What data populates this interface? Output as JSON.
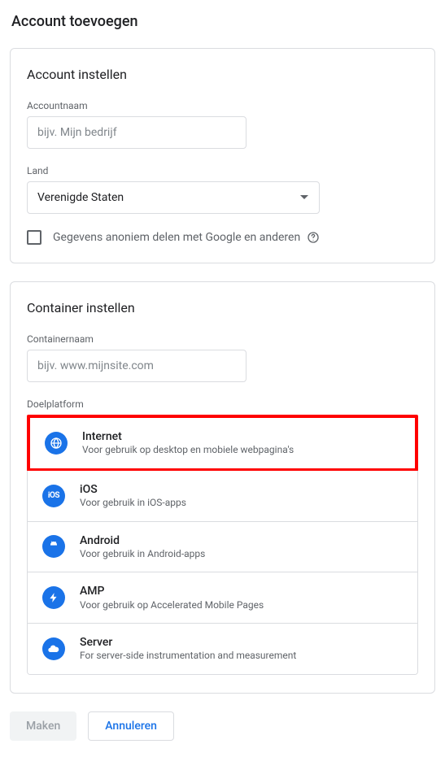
{
  "page_title": "Account toevoegen",
  "account_section": {
    "title": "Account instellen",
    "name_label": "Accountnaam",
    "name_placeholder": "bijv. Mijn bedrijf",
    "country_label": "Land",
    "country_value": "Verenigde Staten",
    "share_checkbox_label": "Gegevens anoniem delen met Google en anderen"
  },
  "container_section": {
    "title": "Container instellen",
    "name_label": "Containernaam",
    "name_placeholder": "bijv. www.mijnsite.com",
    "platform_label": "Doelplatform",
    "platforms": [
      {
        "title": "Internet",
        "desc": "Voor gebruik op desktop en mobiele webpagina's"
      },
      {
        "title": "iOS",
        "desc": "Voor gebruik in iOS-apps"
      },
      {
        "title": "Android",
        "desc": "Voor gebruik in Android-apps"
      },
      {
        "title": "AMP",
        "desc": "Voor gebruik op Accelerated Mobile Pages"
      },
      {
        "title": "Server",
        "desc": "For server-side instrumentation and measurement"
      }
    ]
  },
  "footer": {
    "create_label": "Maken",
    "cancel_label": "Annuleren"
  },
  "colors": {
    "accent": "#1a73e8",
    "highlight": "#ff0000"
  }
}
